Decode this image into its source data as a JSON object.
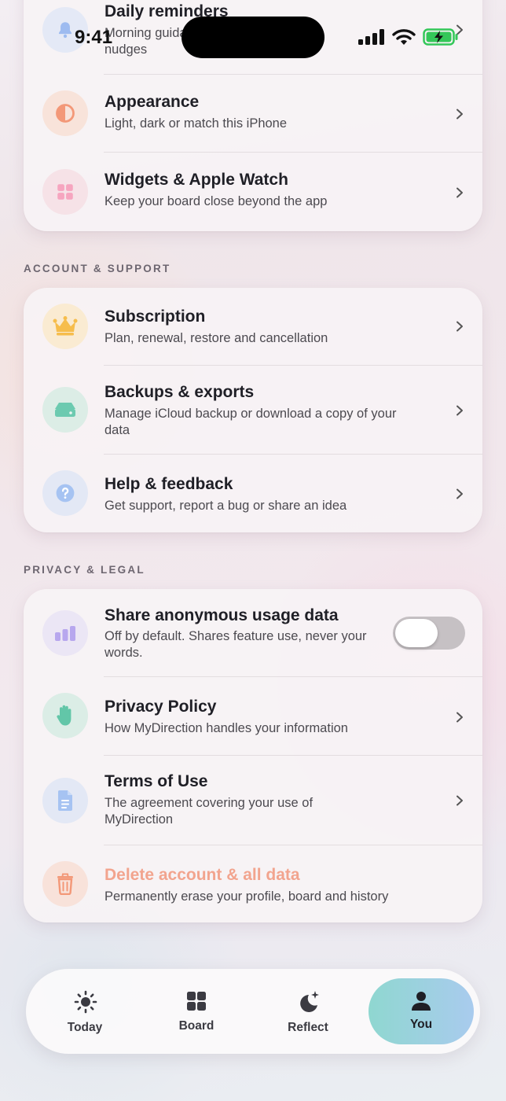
{
  "status_bar": {
    "time": "9:41"
  },
  "colors": {
    "accent_danger": "#f2a48e",
    "tab_active_start": "#8fd7d0",
    "tab_active_end": "#a9cbee"
  },
  "top_card": {
    "items": [
      {
        "title": "Daily reminders",
        "subtitle": "Morning guidance and reflection nudges",
        "icon": "bell-icon"
      },
      {
        "title": "Appearance",
        "subtitle": "Light, dark or match this iPhone",
        "icon": "half-circle-icon"
      },
      {
        "title": "Widgets & Apple Watch",
        "subtitle": "Keep your board close beyond the app",
        "icon": "grid-icon"
      }
    ]
  },
  "sections": [
    {
      "label": "ACCOUNT & SUPPORT",
      "items": [
        {
          "title": "Subscription",
          "subtitle": "Plan, renewal, restore and cancellation",
          "icon": "crown-icon"
        },
        {
          "title": "Backups & exports",
          "subtitle": "Manage iCloud backup or download a copy of your data",
          "icon": "drive-icon"
        },
        {
          "title": "Help & feedback",
          "subtitle": "Get support, report a bug or share an idea",
          "icon": "question-icon"
        }
      ]
    },
    {
      "label": "PRIVACY & LEGAL",
      "items": [
        {
          "title": "Share anonymous usage data",
          "subtitle": "Off by default. Shares feature use, never your words.",
          "icon": "bar-chart-icon",
          "toggle_on": false
        },
        {
          "title": "Privacy Policy",
          "subtitle": "How MyDirection handles your information",
          "icon": "hand-icon"
        },
        {
          "title": "Terms of Use",
          "subtitle": "The agreement covering your use of MyDirection",
          "icon": "document-icon"
        },
        {
          "title": "Delete account & all data",
          "subtitle": "Permanently erase your profile, board and history",
          "icon": "trash-icon"
        }
      ]
    }
  ],
  "tab_bar": {
    "tabs": [
      {
        "label": "Today",
        "icon": "sun-icon",
        "active": false
      },
      {
        "label": "Board",
        "icon": "grid-icon",
        "active": false
      },
      {
        "label": "Reflect",
        "icon": "moon-sparkle-icon",
        "active": false
      },
      {
        "label": "You",
        "icon": "person-icon",
        "active": true
      }
    ]
  }
}
